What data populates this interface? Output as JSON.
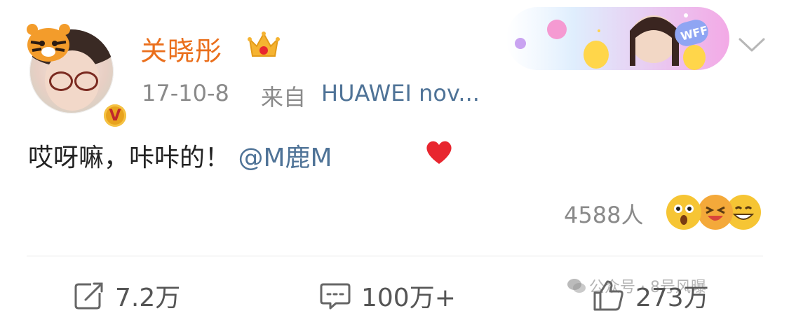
{
  "post": {
    "username": "关晓彤",
    "time": "17-10-8",
    "source_prefix": "来自",
    "device": "HUAWEI nov...",
    "text_main": "哎呀嘛，咔咔的！",
    "mention": "@M鹿M",
    "reaction_count": "4588人"
  },
  "banner": {
    "badge_text": "WFF"
  },
  "actions": {
    "share_count": "7.2万",
    "comment_count": "100万+",
    "like_count": "273万"
  },
  "watermark": {
    "text": "公众号 · 8号风曝"
  },
  "colors": {
    "username": "#ea6f1c",
    "link": "#4f7397",
    "muted": "#8a8a8a",
    "heart": "#e8262f"
  },
  "icons": {
    "crown": "crown-icon",
    "verified": "verified-badge-icon",
    "chevron": "chevron-down-icon",
    "heart": "heart-icon",
    "share": "share-icon",
    "comment": "comment-icon",
    "like": "thumbs-up-icon"
  }
}
